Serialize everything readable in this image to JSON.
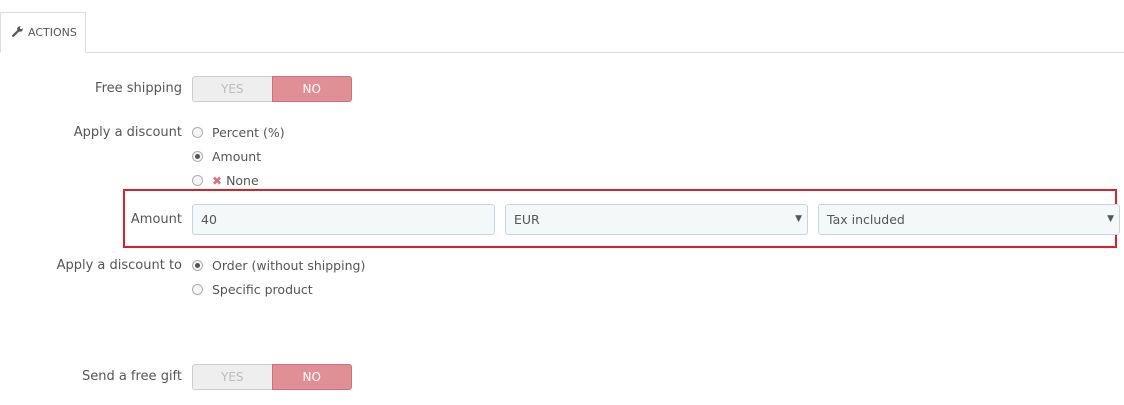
{
  "tab": {
    "label": "ACTIONS",
    "icon": "wrench-icon"
  },
  "free_shipping": {
    "label": "Free shipping",
    "yes": "YES",
    "no": "NO",
    "selected": "NO"
  },
  "discount": {
    "label": "Apply a discount",
    "options": [
      {
        "label": "Percent (%)",
        "checked": false
      },
      {
        "label": "Amount",
        "checked": true
      },
      {
        "label": "None",
        "checked": false,
        "icon": "x-icon"
      }
    ]
  },
  "amount": {
    "label": "Amount",
    "value": "40",
    "currency": "EUR",
    "tax": "Tax included"
  },
  "discount_to": {
    "label": "Apply a discount to",
    "options": [
      {
        "label": "Order (without shipping)",
        "checked": true
      },
      {
        "label": "Specific product",
        "checked": false
      }
    ]
  },
  "free_gift": {
    "label": "Send a free gift",
    "yes": "YES",
    "no": "NO",
    "selected": "NO"
  },
  "colors": {
    "accent_no": "#e08f95",
    "highlight": "#d6222e"
  }
}
